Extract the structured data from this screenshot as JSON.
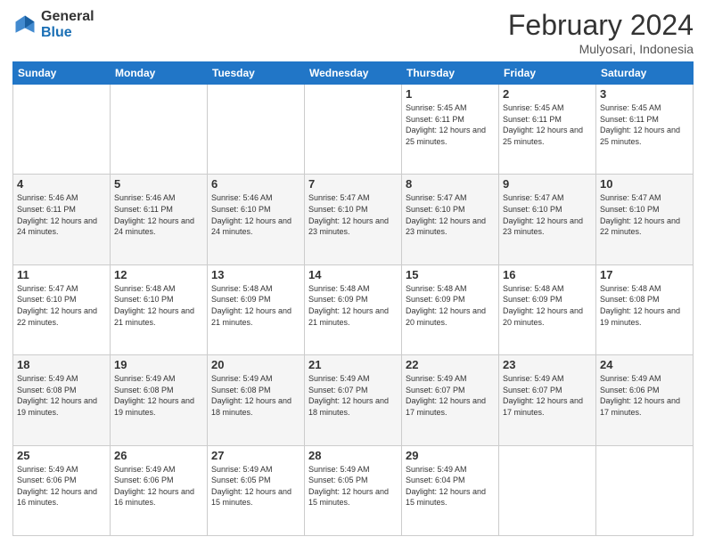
{
  "logo": {
    "general": "General",
    "blue": "Blue"
  },
  "header": {
    "month": "February 2024",
    "location": "Mulyosari, Indonesia"
  },
  "weekdays": [
    "Sunday",
    "Monday",
    "Tuesday",
    "Wednesday",
    "Thursday",
    "Friday",
    "Saturday"
  ],
  "weeks": [
    [
      {
        "day": "",
        "info": ""
      },
      {
        "day": "",
        "info": ""
      },
      {
        "day": "",
        "info": ""
      },
      {
        "day": "",
        "info": ""
      },
      {
        "day": "1",
        "info": "Sunrise: 5:45 AM\nSunset: 6:11 PM\nDaylight: 12 hours\nand 25 minutes."
      },
      {
        "day": "2",
        "info": "Sunrise: 5:45 AM\nSunset: 6:11 PM\nDaylight: 12 hours\nand 25 minutes."
      },
      {
        "day": "3",
        "info": "Sunrise: 5:45 AM\nSunset: 6:11 PM\nDaylight: 12 hours\nand 25 minutes."
      }
    ],
    [
      {
        "day": "4",
        "info": "Sunrise: 5:46 AM\nSunset: 6:11 PM\nDaylight: 12 hours\nand 24 minutes."
      },
      {
        "day": "5",
        "info": "Sunrise: 5:46 AM\nSunset: 6:11 PM\nDaylight: 12 hours\nand 24 minutes."
      },
      {
        "day": "6",
        "info": "Sunrise: 5:46 AM\nSunset: 6:10 PM\nDaylight: 12 hours\nand 24 minutes."
      },
      {
        "day": "7",
        "info": "Sunrise: 5:47 AM\nSunset: 6:10 PM\nDaylight: 12 hours\nand 23 minutes."
      },
      {
        "day": "8",
        "info": "Sunrise: 5:47 AM\nSunset: 6:10 PM\nDaylight: 12 hours\nand 23 minutes."
      },
      {
        "day": "9",
        "info": "Sunrise: 5:47 AM\nSunset: 6:10 PM\nDaylight: 12 hours\nand 23 minutes."
      },
      {
        "day": "10",
        "info": "Sunrise: 5:47 AM\nSunset: 6:10 PM\nDaylight: 12 hours\nand 22 minutes."
      }
    ],
    [
      {
        "day": "11",
        "info": "Sunrise: 5:47 AM\nSunset: 6:10 PM\nDaylight: 12 hours\nand 22 minutes."
      },
      {
        "day": "12",
        "info": "Sunrise: 5:48 AM\nSunset: 6:10 PM\nDaylight: 12 hours\nand 21 minutes."
      },
      {
        "day": "13",
        "info": "Sunrise: 5:48 AM\nSunset: 6:09 PM\nDaylight: 12 hours\nand 21 minutes."
      },
      {
        "day": "14",
        "info": "Sunrise: 5:48 AM\nSunset: 6:09 PM\nDaylight: 12 hours\nand 21 minutes."
      },
      {
        "day": "15",
        "info": "Sunrise: 5:48 AM\nSunset: 6:09 PM\nDaylight: 12 hours\nand 20 minutes."
      },
      {
        "day": "16",
        "info": "Sunrise: 5:48 AM\nSunset: 6:09 PM\nDaylight: 12 hours\nand 20 minutes."
      },
      {
        "day": "17",
        "info": "Sunrise: 5:48 AM\nSunset: 6:08 PM\nDaylight: 12 hours\nand 19 minutes."
      }
    ],
    [
      {
        "day": "18",
        "info": "Sunrise: 5:49 AM\nSunset: 6:08 PM\nDaylight: 12 hours\nand 19 minutes."
      },
      {
        "day": "19",
        "info": "Sunrise: 5:49 AM\nSunset: 6:08 PM\nDaylight: 12 hours\nand 19 minutes."
      },
      {
        "day": "20",
        "info": "Sunrise: 5:49 AM\nSunset: 6:08 PM\nDaylight: 12 hours\nand 18 minutes."
      },
      {
        "day": "21",
        "info": "Sunrise: 5:49 AM\nSunset: 6:07 PM\nDaylight: 12 hours\nand 18 minutes."
      },
      {
        "day": "22",
        "info": "Sunrise: 5:49 AM\nSunset: 6:07 PM\nDaylight: 12 hours\nand 17 minutes."
      },
      {
        "day": "23",
        "info": "Sunrise: 5:49 AM\nSunset: 6:07 PM\nDaylight: 12 hours\nand 17 minutes."
      },
      {
        "day": "24",
        "info": "Sunrise: 5:49 AM\nSunset: 6:06 PM\nDaylight: 12 hours\nand 17 minutes."
      }
    ],
    [
      {
        "day": "25",
        "info": "Sunrise: 5:49 AM\nSunset: 6:06 PM\nDaylight: 12 hours\nand 16 minutes."
      },
      {
        "day": "26",
        "info": "Sunrise: 5:49 AM\nSunset: 6:06 PM\nDaylight: 12 hours\nand 16 minutes."
      },
      {
        "day": "27",
        "info": "Sunrise: 5:49 AM\nSunset: 6:05 PM\nDaylight: 12 hours\nand 15 minutes."
      },
      {
        "day": "28",
        "info": "Sunrise: 5:49 AM\nSunset: 6:05 PM\nDaylight: 12 hours\nand 15 minutes."
      },
      {
        "day": "29",
        "info": "Sunrise: 5:49 AM\nSunset: 6:04 PM\nDaylight: 12 hours\nand 15 minutes."
      },
      {
        "day": "",
        "info": ""
      },
      {
        "day": "",
        "info": ""
      }
    ]
  ]
}
